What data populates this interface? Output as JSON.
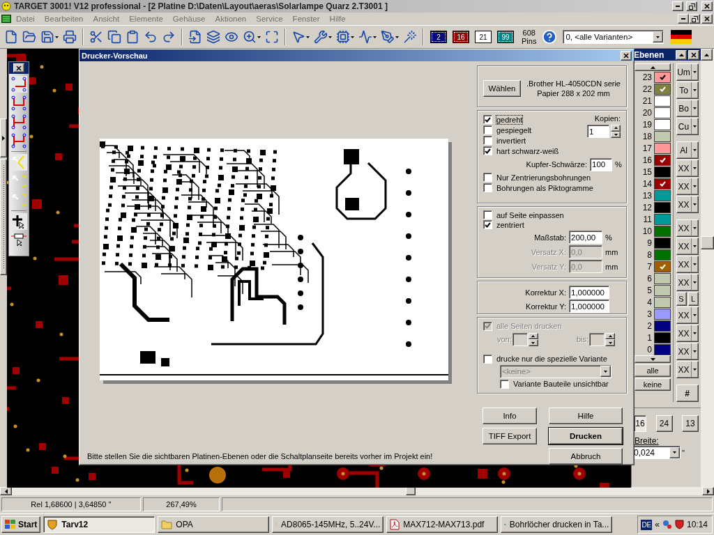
{
  "window": {
    "title": "TARGET 3001! V12 professional - [2 Platine D:\\Daten\\Layout\\aeras\\Solarlampe Quarz 2.T3001 ]"
  },
  "menu": [
    "Datei",
    "Bearbeiten",
    "Ansicht",
    "Elemente",
    "Gehäuse",
    "Aktionen",
    "Service",
    "Fenster",
    "Hilfe"
  ],
  "toolbar": {
    "layer_badges": [
      {
        "label": "2",
        "color": "#000080"
      },
      {
        "label": "16",
        "color": "#990000"
      },
      {
        "label": "21",
        "color": "#ffffff"
      },
      {
        "label": "99",
        "color": "#008080"
      }
    ],
    "pins_count": "608",
    "pins_label": "Pins",
    "variant_select": "0, <alle Varianten>"
  },
  "print_preview": {
    "title": "Drucker-Vorschau",
    "hint": "Bitte stellen Sie die sichtbaren Platinen-Ebenen oder die Schaltplanseite bereits vorher im Projekt ein!",
    "printer": {
      "button": "Wählen",
      "name": ".Brother HL-4050CDN serie",
      "paper": "Papier 288 x 202 mm"
    },
    "output_options": [
      {
        "label": "gedreht",
        "checked": true
      },
      {
        "label": "gespiegelt",
        "checked": false
      },
      {
        "label": "invertiert",
        "checked": false
      },
      {
        "label": "hart schwarz-weiß",
        "checked": true
      }
    ],
    "copies": {
      "label": "Kopien:",
      "value": "1"
    },
    "copper_blackness": {
      "label": "Kupfer-Schwärze:",
      "value": "100",
      "unit": "%"
    },
    "drill_options": [
      {
        "label": "Nur Zentrierungsbohrungen",
        "checked": false
      },
      {
        "label": "Bohrungen als Piktogramme",
        "checked": false
      }
    ],
    "placement_options": [
      {
        "label": "auf Seite einpassen",
        "checked": false
      },
      {
        "label": "zentriert",
        "checked": true
      }
    ],
    "placement_fields": [
      {
        "label": "Maßstab:",
        "value": "200,00",
        "unit": "%",
        "disabled": false
      },
      {
        "label": "Versatz X:",
        "value": "0,0",
        "unit": "mm",
        "disabled": true
      },
      {
        "label": "Versatz Y:",
        "value": "0,0",
        "unit": "mm",
        "disabled": true
      }
    ],
    "correction_fields": [
      {
        "label": "Korrektur X:",
        "value": "1,000000"
      },
      {
        "label": "Korrektur Y:",
        "value": "1,000000"
      }
    ],
    "all_pages": {
      "label": "alle Seiten drucken",
      "checked": true,
      "disabled": true,
      "from_label": "von:",
      "to_label": "bis:"
    },
    "variant": {
      "label": "drucke nur die spezielle Variante",
      "checked": false,
      "select": "<keine>",
      "select_disabled": true,
      "hide_label": "Variante Bauteile unsichtbar",
      "hide_checked": false
    },
    "buttons": [
      {
        "label": "Info",
        "default": false
      },
      {
        "label": "Hilfe",
        "default": false
      },
      {
        "label": "TIFF Export",
        "default": false
      },
      {
        "label": "Drucken",
        "default": true
      },
      {
        "label": "Abbruch",
        "default": false
      }
    ]
  },
  "layers_panel": {
    "title": "Ebenen",
    "layers": [
      {
        "number": "23",
        "color": "#ff9999",
        "checked": true
      },
      {
        "number": "22",
        "color": "#808040",
        "checked": true
      },
      {
        "number": "21",
        "color": "#ffffff",
        "checked": false
      },
      {
        "number": "20",
        "color": "#ffffff",
        "checked": false
      },
      {
        "number": "19",
        "color": "#ffffff",
        "checked": false
      },
      {
        "number": "18",
        "color": "#c0c8b0",
        "checked": false
      },
      {
        "number": "17",
        "color": "#ff9999",
        "checked": false
      },
      {
        "number": "16",
        "color": "#990000",
        "checked": true
      },
      {
        "number": "15",
        "color": "#000000",
        "checked": false
      },
      {
        "number": "14",
        "color": "#990000",
        "checked": true
      },
      {
        "number": "13",
        "color": "#009999",
        "checked": false
      },
      {
        "number": "12",
        "color": "#000000",
        "checked": false
      },
      {
        "number": "11",
        "color": "#009999",
        "checked": false
      },
      {
        "number": "10",
        "color": "#007000",
        "checked": false
      },
      {
        "number": "9",
        "color": "#000000",
        "checked": false
      },
      {
        "number": "8",
        "color": "#007000",
        "checked": false
      },
      {
        "number": "7",
        "color": "#a06000",
        "checked": true
      },
      {
        "number": "6",
        "color": "#c0c8b0",
        "checked": false
      },
      {
        "number": "5",
        "color": "#c0c8b0",
        "checked": false
      },
      {
        "number": "4",
        "color": "#c0c8b0",
        "checked": false
      },
      {
        "number": "3",
        "color": "#9999ff",
        "checked": false
      },
      {
        "number": "2",
        "color": "#000080",
        "checked": false
      },
      {
        "number": "1",
        "color": "#000000",
        "checked": false
      },
      {
        "number": "0",
        "color": "#000080",
        "checked": false
      }
    ],
    "show_all": "alle",
    "show_none": "keine",
    "tool_groups": [
      [
        {
          "kind": "dropdown",
          "label": "Um"
        },
        {
          "kind": "dropdown",
          "label": "To"
        },
        {
          "kind": "dropdown",
          "label": "Bo"
        },
        {
          "kind": "dropdown",
          "label": "Cu"
        }
      ],
      [
        {
          "kind": "dropdown",
          "label": "Al"
        },
        {
          "kind": "dropdown",
          "label": "XX"
        },
        {
          "kind": "dropdown",
          "label": "XX"
        },
        {
          "kind": "dropdown",
          "label": "XX"
        }
      ],
      [
        {
          "kind": "dropdown",
          "label": "XX"
        },
        {
          "kind": "dropdown",
          "label": "XX"
        },
        {
          "kind": "dropdown",
          "label": "XX"
        },
        {
          "kind": "dropdown",
          "label": "XX"
        },
        {
          "kind": "pair",
          "labels": [
            "S",
            "L"
          ]
        },
        {
          "kind": "dropdown",
          "label": "XX"
        },
        {
          "kind": "dropdown",
          "label": "XX"
        },
        {
          "kind": "dropdown",
          "label": "XX"
        },
        {
          "kind": "dropdown",
          "label": "XX"
        }
      ],
      [
        {
          "kind": "plain",
          "label": "#"
        }
      ]
    ],
    "grid_buttons": [
      {
        "label": "16",
        "selected": true
      },
      {
        "label": "24",
        "selected": false
      },
      {
        "label": "13",
        "selected": false
      }
    ],
    "width_label": "Breite:",
    "width_value": "0,024",
    "width_unit": "\""
  },
  "status_bar": {
    "coordinates": "Rel 1,68600 | 3,64850 ''",
    "zoom": "267,49%"
  },
  "taskbar": {
    "start": "Start",
    "tasks": [
      {
        "kind": "app",
        "label": "Tarv12",
        "selected": true
      },
      {
        "kind": "folder",
        "label": "OPA",
        "selected": false
      },
      {
        "kind": "pdf",
        "label": "AD8065-145MHz, 5..24V...",
        "selected": false
      },
      {
        "kind": "pdf",
        "label": "MAX712-MAX713.pdf",
        "selected": false
      },
      {
        "kind": "browser",
        "label": "Bohrlöcher drucken in Ta...",
        "selected": false
      }
    ],
    "language": "DE",
    "tray_toggle": "«",
    "clock": "10:14"
  }
}
